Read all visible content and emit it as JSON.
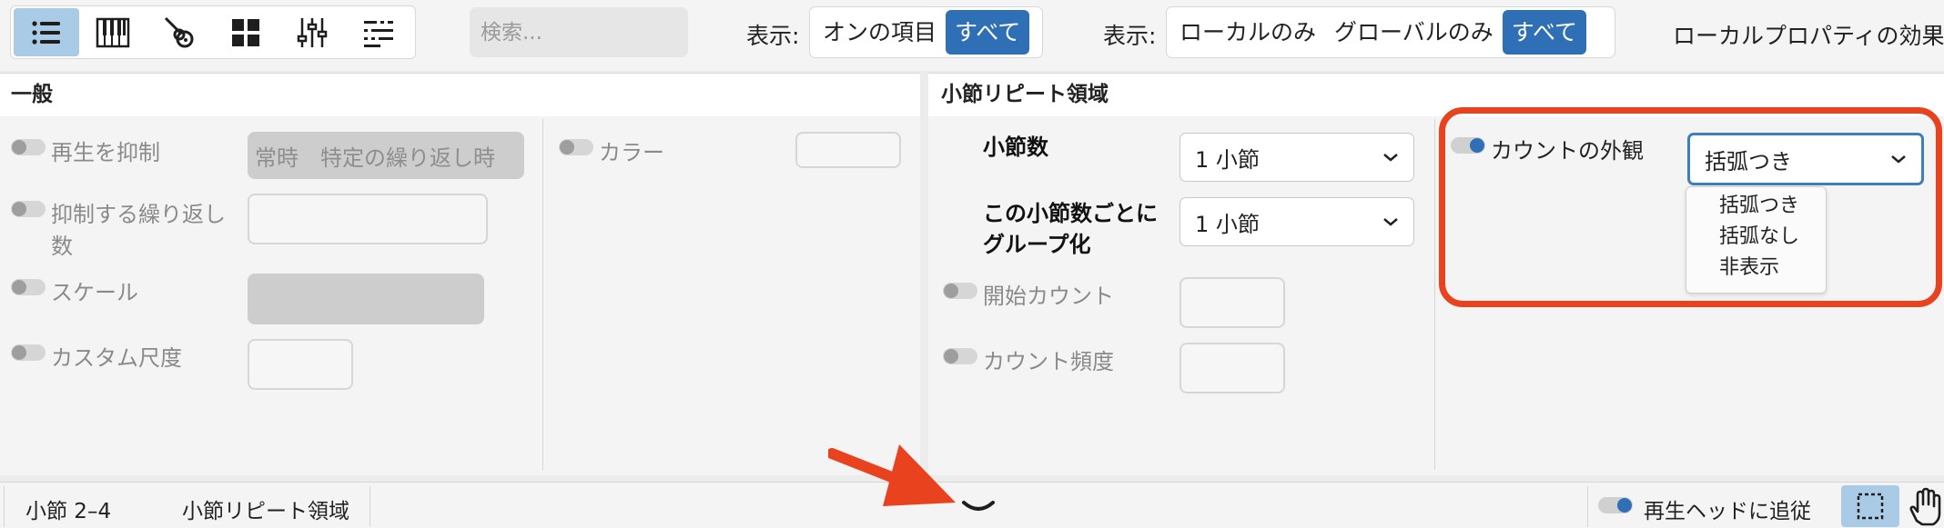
{
  "toolbar": {
    "icons": [
      "list-icon",
      "piano-icon",
      "guitar-icon",
      "grid-icon",
      "mixer-icon",
      "outline-icon"
    ],
    "active_icon": "list-icon",
    "search_placeholder": "検索...",
    "filter1": {
      "label": "表示:",
      "options": [
        "オンの項目",
        "すべて"
      ],
      "selected": "すべて"
    },
    "filter2": {
      "label": "表示:",
      "options": [
        "ローカルのみ",
        "グローバルのみ",
        "すべて"
      ],
      "selected": "すべて"
    },
    "local_effect_label": "ローカルプロパティの効果"
  },
  "general": {
    "title": "一般",
    "playback_suppress": {
      "label": "再生を抑制",
      "options": [
        "常時",
        "特定の繰り返し時"
      ]
    },
    "suppress_repeats_label_line1": "抑制する繰り返し",
    "suppress_repeats_label_line2": "数",
    "scale_label": "スケール",
    "custom_scale_label": "カスタム尺度",
    "color_label": "カラー"
  },
  "repeat": {
    "title": "小節リピート領域",
    "bars_label": "小節数",
    "bars_value": "1 小節",
    "group_label_line1": "この小節数ごとに",
    "group_label_line2": "グループ化",
    "group_value": "1 小節",
    "start_count_label": "開始カウント",
    "count_freq_label": "カウント頻度",
    "count_appearance_label": "カウントの外観",
    "count_appearance_value": "括弧つき",
    "count_appearance_options": [
      "括弧つき",
      "括弧なし",
      "非表示"
    ]
  },
  "statusbar": {
    "range": "小節 2–4",
    "selection_type": "小節リピート領域",
    "follow_playhead": "再生ヘッドに追従"
  },
  "colors": {
    "accent": "#2f6fb5",
    "annotation": "#e8421e",
    "active_icon_bg": "#a9cbe6"
  }
}
